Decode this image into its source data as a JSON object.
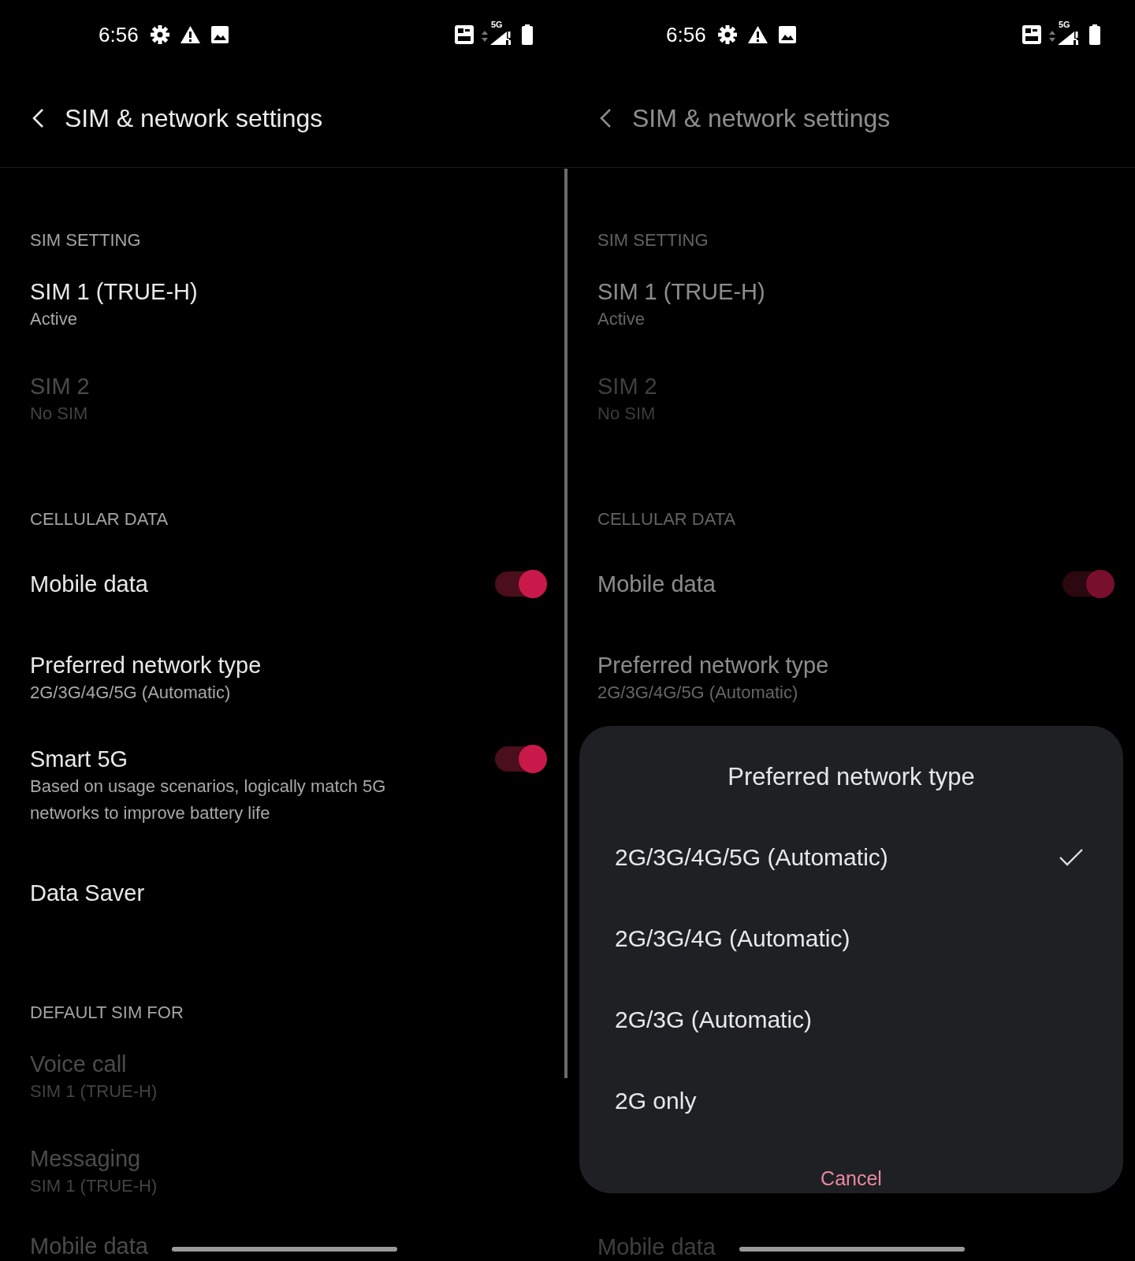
{
  "screens": [
    {
      "status_bar": {
        "time": "6:56",
        "network": "5G"
      },
      "header": {
        "title": "SIM & network settings"
      },
      "scrim": false,
      "items": [
        {
          "kind": "section",
          "title": "SIM SETTING"
        },
        {
          "kind": "item",
          "title": "SIM 1  (TRUE-H)",
          "subtitle": "Active",
          "disabled": false
        },
        {
          "kind": "item",
          "title": "SIM 2",
          "subtitle": "No SIM",
          "disabled": true
        },
        {
          "kind": "section",
          "title": "CELLULAR DATA"
        },
        {
          "kind": "toggle",
          "title": "Mobile data",
          "on": true,
          "disabled": false
        },
        {
          "kind": "item",
          "title": "Preferred network type",
          "subtitle": "2G/3G/4G/5G (Automatic)",
          "disabled": false
        },
        {
          "kind": "toggle",
          "title": "Smart 5G",
          "subtitle": "Based on usage scenarios, logically match 5G networks to improve battery life",
          "on": true,
          "disabled": false
        },
        {
          "kind": "item",
          "title": "Data Saver",
          "disabled": false
        },
        {
          "kind": "section",
          "title": "DEFAULT SIM FOR"
        },
        {
          "kind": "item",
          "title": "Voice call",
          "subtitle": "SIM 1  (TRUE-H)",
          "disabled": true
        },
        {
          "kind": "item",
          "title": "Messaging",
          "subtitle": "SIM 1  (TRUE-H)",
          "disabled": true
        },
        {
          "kind": "item",
          "title": "Mobile data",
          "disabled": true
        }
      ]
    },
    {
      "status_bar": {
        "time": "6:56",
        "network": "5G"
      },
      "header": {
        "title": "SIM & network settings"
      },
      "scrim": true,
      "items": [
        {
          "kind": "section",
          "title": "SIM SETTING"
        },
        {
          "kind": "item",
          "title": "SIM 1  (TRUE-H)",
          "subtitle": "Active",
          "disabled": false
        },
        {
          "kind": "item",
          "title": "SIM 2",
          "subtitle": "No SIM",
          "disabled": true
        },
        {
          "kind": "section",
          "title": "CELLULAR DATA"
        },
        {
          "kind": "toggle",
          "title": "Mobile data",
          "on": true,
          "disabled": false
        },
        {
          "kind": "item",
          "title": "Preferred network type",
          "subtitle": "2G/3G/4G/5G (Automatic)",
          "disabled": false
        },
        {
          "kind": "dialog",
          "title": "Preferred network type",
          "options": [
            {
              "label": "2G/3G/4G/5G (Automatic)",
              "selected": true
            },
            {
              "label": "2G/3G/4G (Automatic)",
              "selected": false
            },
            {
              "label": "2G/3G (Automatic)",
              "selected": false
            },
            {
              "label": "2G only",
              "selected": false
            }
          ],
          "cancel": "Cancel"
        },
        {
          "kind": "item",
          "title": "Mobile data",
          "disabled": true
        }
      ]
    }
  ]
}
